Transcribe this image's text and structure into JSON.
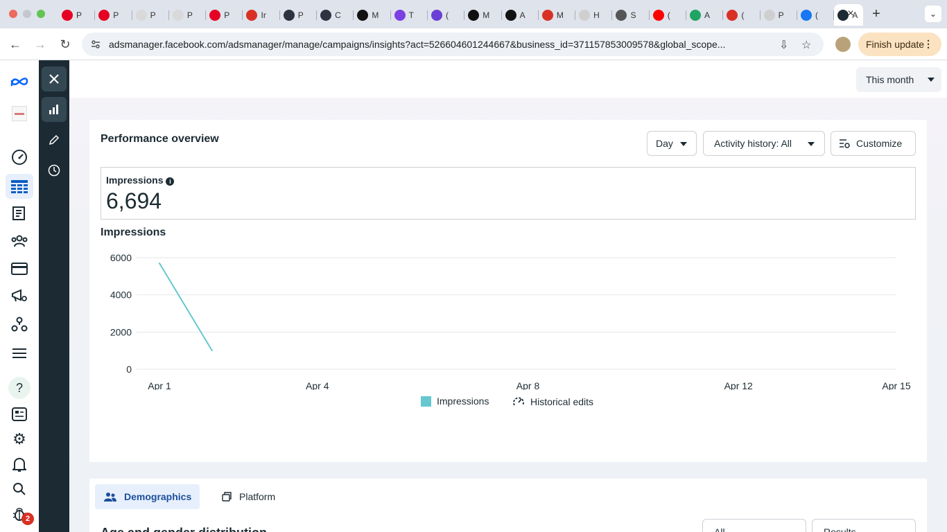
{
  "browser": {
    "tabs": [
      {
        "label": "P",
        "icon": "pinterest-icon",
        "color": "#e60023"
      },
      {
        "label": "P",
        "icon": "pinterest-icon",
        "color": "#e60023"
      },
      {
        "label": "P",
        "icon": "page-icon",
        "color": "#d9d9d9"
      },
      {
        "label": "P",
        "icon": "page-icon",
        "color": "#d9d9d9"
      },
      {
        "label": "P",
        "icon": "pinterest-icon",
        "color": "#e60023"
      },
      {
        "label": "Ir",
        "icon": "gmail-icon",
        "color": "#d93025"
      },
      {
        "label": "P",
        "icon": "openai-icon",
        "color": "#2d3340"
      },
      {
        "label": "C",
        "icon": "openai-icon",
        "color": "#2d3340"
      },
      {
        "label": "M",
        "icon": "threads-icon",
        "color": "#111111"
      },
      {
        "label": "T",
        "icon": "app-icon",
        "color": "#7b3fe4"
      },
      {
        "label": "(",
        "icon": "app-icon",
        "color": "#6a3fd6"
      },
      {
        "label": "M",
        "icon": "threads-icon",
        "color": "#111111"
      },
      {
        "label": "A",
        "icon": "threads-icon",
        "color": "#111111"
      },
      {
        "label": "M",
        "icon": "gmail-icon",
        "color": "#d93025"
      },
      {
        "label": "H",
        "icon": "page-icon",
        "color": "#cfcfcf"
      },
      {
        "label": "S",
        "icon": "globe-icon",
        "color": "#555555"
      },
      {
        "label": "(",
        "icon": "youtube-icon",
        "color": "#ff0000"
      },
      {
        "label": "A",
        "icon": "drive-icon",
        "color": "#1fa463"
      },
      {
        "label": "(",
        "icon": "gmail-icon",
        "color": "#d93025"
      },
      {
        "label": "P",
        "icon": "page-icon",
        "color": "#cfcfcf"
      },
      {
        "label": "(",
        "icon": "facebook-icon",
        "color": "#1877f2"
      },
      {
        "label": "A",
        "icon": "meta-icon",
        "color": "#1c2b33"
      }
    ],
    "url": "adsmanager.facebook.com/adsmanager/manage/campaigns/insights?act=526604601244667&business_id=371157853009578&global_scope...",
    "finish_update": "Finish update"
  },
  "rail_icons": [
    "meta-logo-icon",
    "account-thumbnail-icon",
    "dashboard-gauge-icon",
    "campaigns-table-icon",
    "pages-icon",
    "audiences-icon",
    "billing-card-icon",
    "ads-megaphone-icon",
    "business-network-icon",
    "menu-icon",
    "help-icon",
    "news-icon",
    "settings-icon",
    "notifications-icon",
    "search-icon",
    "bug-icon"
  ],
  "notifications_count": "2",
  "top": {
    "period": "This month"
  },
  "overview": {
    "title": "Performance overview",
    "granularity": "Day",
    "activity": "Activity history: All",
    "customize": "Customize",
    "metric_label": "Impressions",
    "metric_value": "6,694",
    "chart_title": "Impressions",
    "legend_impressions": "Impressions",
    "legend_edits": "Historical edits"
  },
  "chart_data": {
    "type": "line",
    "title": "Impressions",
    "xlabel": "",
    "ylabel": "",
    "x_ticks": [
      "Apr 1",
      "Apr 4",
      "Apr 8",
      "Apr 12",
      "Apr 15"
    ],
    "x_tick_days": [
      1,
      4,
      8,
      12,
      15
    ],
    "y_ticks": [
      0,
      2000,
      4000,
      6000
    ],
    "ylim": [
      0,
      6000
    ],
    "xlim": [
      1,
      15
    ],
    "series": [
      {
        "name": "Impressions",
        "color": "#66c7cf",
        "x": [
          1,
          2
        ],
        "values": [
          5700,
          1000
        ]
      }
    ],
    "grid": true,
    "legend": "bottom-center"
  },
  "breakdown": {
    "tab_demographics": "Demographics",
    "tab_platform": "Platform",
    "heading": "Age and gender distribution",
    "select_1": "All",
    "select_2": "Results"
  }
}
